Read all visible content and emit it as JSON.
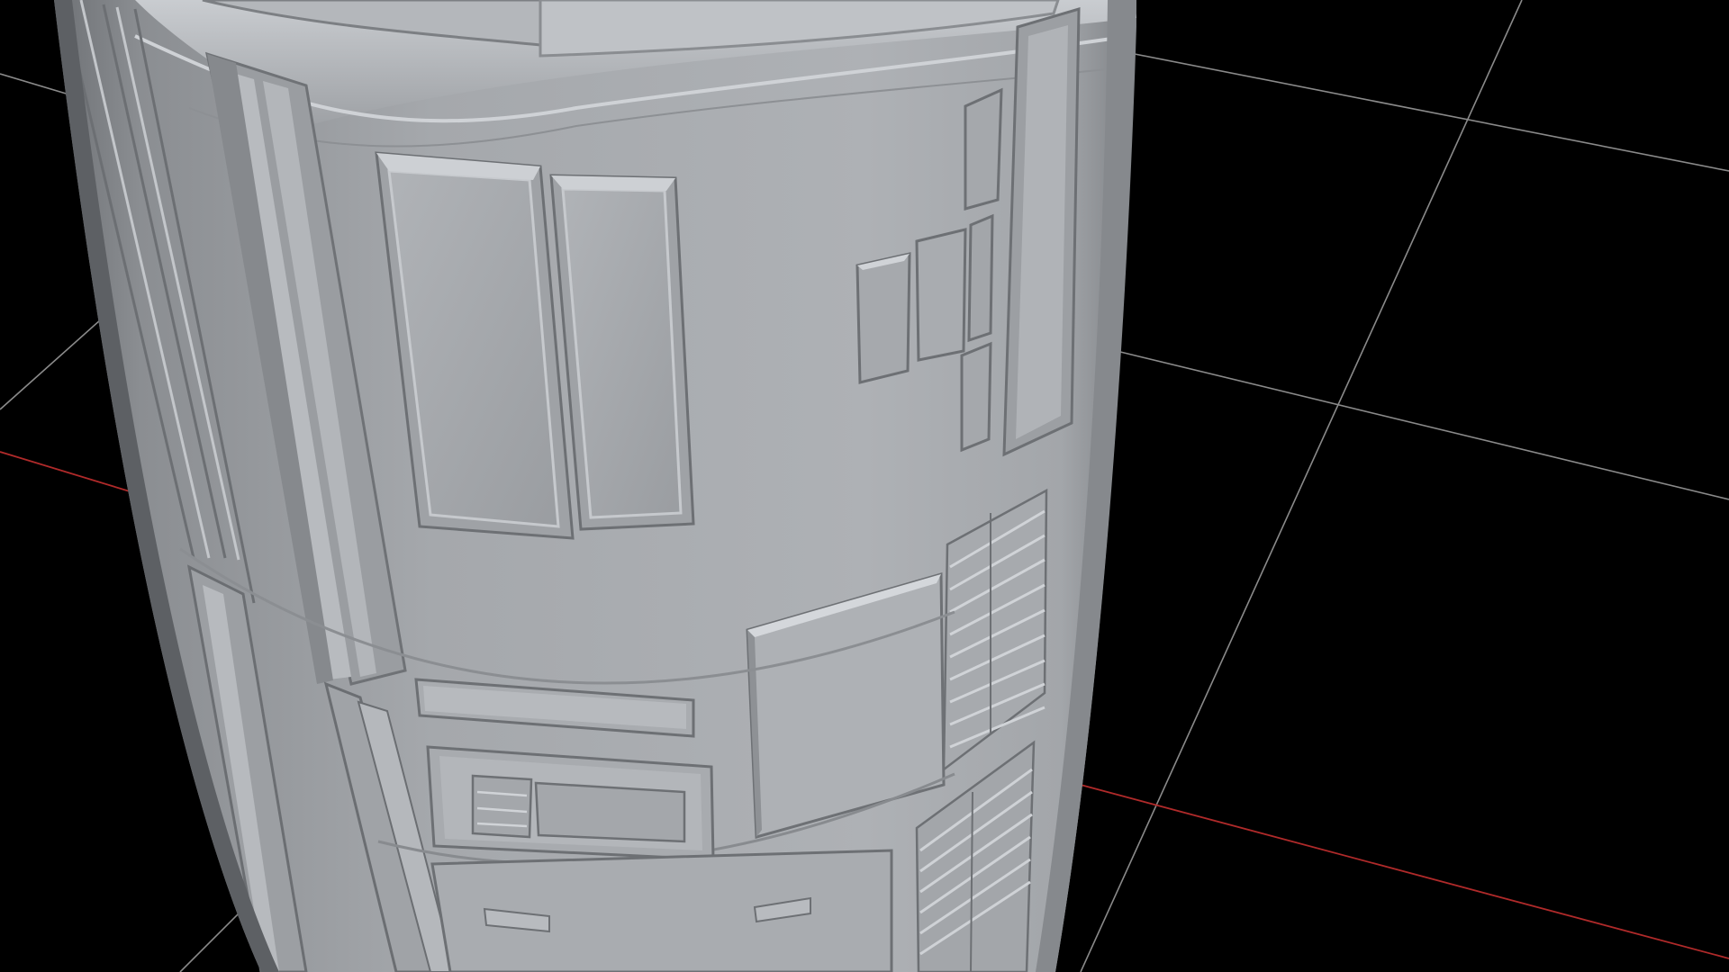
{
  "viewport": {
    "background_color": "#000000",
    "grid_color": "#8a8a8a",
    "x_axis_color": "#b02a2a",
    "model_color": "#a7aaae",
    "model_shadow_color": "#6f7276",
    "model_highlight_color": "#d7dadd",
    "grid_visible": true,
    "axis_visible": true,
    "shading": "solid grey clay"
  }
}
